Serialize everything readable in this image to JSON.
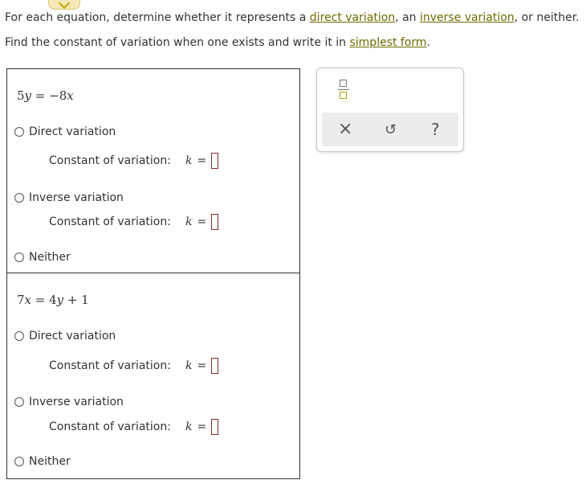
{
  "instructions": {
    "line1": {
      "prefix": "For each equation, determine whether it represents a ",
      "link1": "direct variation",
      "mid": ", an ",
      "link2": "inverse variation",
      "suffix": ", or neither."
    },
    "line2": {
      "prefix": "Find the constant of variation when one exists and write it in ",
      "link": "simplest form",
      "suffix": "."
    }
  },
  "problems": [
    {
      "equation": {
        "left": "5",
        "lv": "y",
        "eq": " = ",
        "right": "−8",
        "rv": "x"
      },
      "options": [
        "Direct variation",
        "Inverse variation",
        "Neither"
      ],
      "constant_label": "Constant of variation:",
      "k": "k",
      "eq_sign": "="
    },
    {
      "equation": {
        "left": "7",
        "lv": "x",
        "eq": " = ",
        "right": "4",
        "rv": "y",
        "tail": " + 1"
      },
      "options": [
        "Direct variation",
        "Inverse variation",
        "Neither"
      ],
      "constant_label": "Constant of variation:",
      "k": "k",
      "eq_sign": "="
    }
  ],
  "toolbox": {
    "clear": "×",
    "undo": "↺",
    "help": "?"
  }
}
